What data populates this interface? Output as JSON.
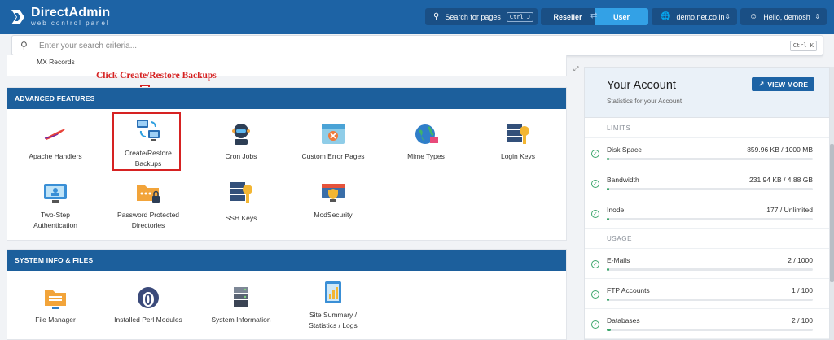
{
  "brand": {
    "name": "DirectAdmin",
    "tagline": "web control panel"
  },
  "topbar": {
    "search_pages": "Search for pages",
    "search_pages_shortcut": "Ctrl J",
    "roles": [
      "Reseller",
      "User"
    ],
    "active_role": "User",
    "domain": "demo.net.co.in",
    "greeting": "Hello, demosh"
  },
  "search": {
    "placeholder": "Enter your search criteria...",
    "shortcut": "Ctrl K",
    "value": ""
  },
  "prev_section": {
    "last_item": "MX Records"
  },
  "annotation": {
    "text": "Click Create/Restore Backups"
  },
  "advanced": {
    "title": "ADVANCED FEATURES",
    "items": [
      {
        "label": "Apache Handlers"
      },
      {
        "label": "Create/Restore Backups"
      },
      {
        "label": "Cron Jobs"
      },
      {
        "label": "Custom Error Pages"
      },
      {
        "label": "Mime Types"
      },
      {
        "label": "Login Keys"
      },
      {
        "label": "Two-Step Authentication"
      },
      {
        "label": "Password Protected Directories"
      },
      {
        "label": "SSH Keys"
      },
      {
        "label": "ModSecurity"
      }
    ]
  },
  "system": {
    "title": "SYSTEM INFO & FILES",
    "items": [
      {
        "label": "File Manager"
      },
      {
        "label": "Installed Perl Modules"
      },
      {
        "label": "System Information"
      },
      {
        "label": "Site Summary / Statistics / Logs"
      }
    ]
  },
  "account": {
    "title": "Your Account",
    "subtitle": "Statistics for your Account",
    "view_more": "VIEW MORE",
    "limits_title": "LIMITS",
    "limits": [
      {
        "name": "Disk Space",
        "value": "859.96 KB / 1000 MB",
        "fraction": 0.001
      },
      {
        "name": "Bandwidth",
        "value": "231.94 KB / 4.88 GB",
        "fraction": 0.0001
      },
      {
        "name": "Inode",
        "value": "177 / Unlimited",
        "fraction": 0.0
      }
    ],
    "usage_title": "USAGE",
    "usage": [
      {
        "name": "E-Mails",
        "value": "2 / 1000",
        "fraction": 0.002
      },
      {
        "name": "FTP Accounts",
        "value": "1 / 100",
        "fraction": 0.01
      },
      {
        "name": "Databases",
        "value": "2 / 100",
        "fraction": 0.02
      }
    ]
  },
  "colors": {
    "topbar": "#1d63a5",
    "section_header": "#1c5f9c",
    "accent": "#33a1e6",
    "ok": "#3aa66a",
    "annotation": "#d62222"
  }
}
